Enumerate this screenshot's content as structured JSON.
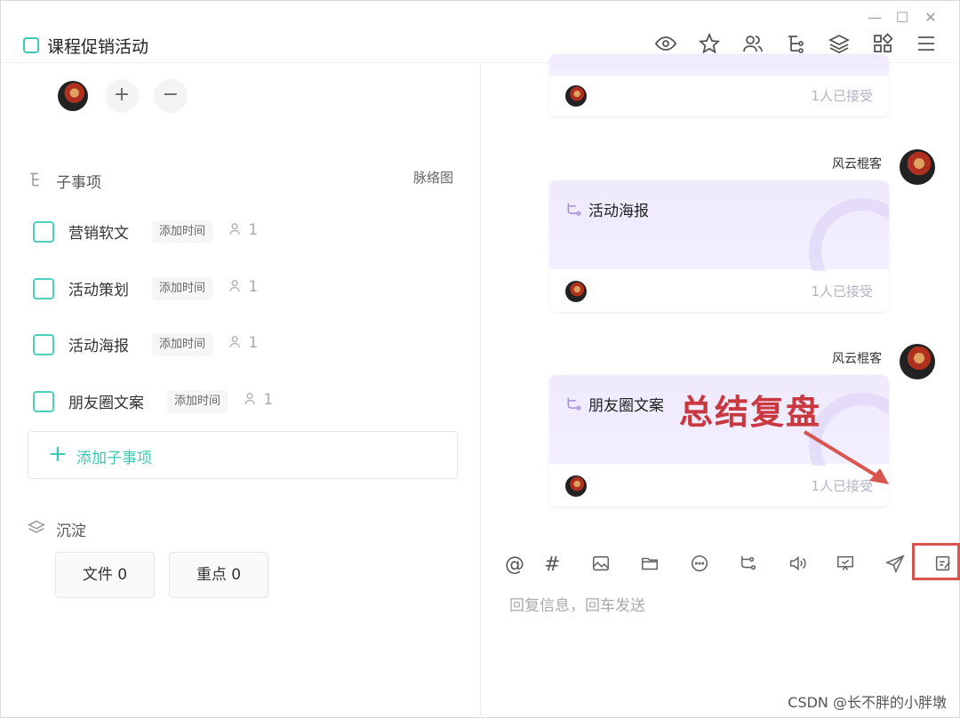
{
  "window": {
    "title": "课程促销活动",
    "controls": [
      "—",
      "☐",
      "✕"
    ]
  },
  "toolbar": {
    "icons": [
      "eye-icon",
      "star-icon",
      "members-icon",
      "tree-icon",
      "layers-icon",
      "apps-icon",
      "menu-icon"
    ]
  },
  "members": {
    "add_label": "+",
    "remove_label": "−"
  },
  "subitems": {
    "title": "子事项",
    "mindmap_label": "脉络图",
    "items": [
      {
        "label": "营销软文",
        "time": "添加时间",
        "count": "1"
      },
      {
        "label": "活动策划",
        "time": "添加时间",
        "count": "1"
      },
      {
        "label": "活动海报",
        "time": "添加时间",
        "count": "1"
      },
      {
        "label": "朋友圈文案",
        "time": "添加时间",
        "count": "1"
      }
    ],
    "add_label": "添加子事项"
  },
  "deposit": {
    "title": "沉淀",
    "file_label": "文件 0",
    "key_label": "重点 0"
  },
  "chat": {
    "messages": [
      {
        "sender": "",
        "title": "",
        "accepted": "1人已接受"
      },
      {
        "sender": "风云棍客",
        "title": "活动海报",
        "accepted": "1人已接受"
      },
      {
        "sender": "风云棍客",
        "title": "朋友圈文案",
        "accepted": "1人已接受"
      }
    ],
    "reply_placeholder": "回复信息，回车发送",
    "at_label": "@",
    "hash_label": "#"
  },
  "annotation": {
    "text": "总结复盘",
    "color": "#c9373f"
  },
  "watermark": "CSDN @长不胖的小胖墩",
  "colors": {
    "accent": "#3bc8b4",
    "card_bg": "#efeafc",
    "highlight": "#d9534f"
  }
}
